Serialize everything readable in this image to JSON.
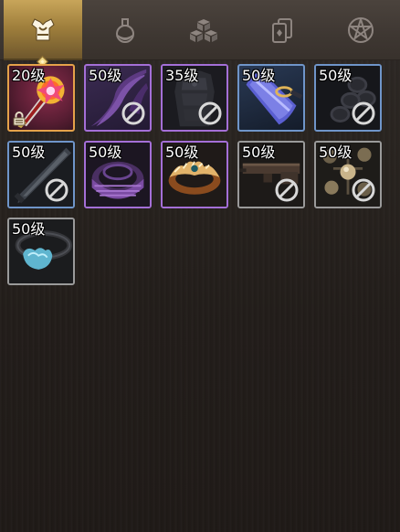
{
  "tabs": [
    {
      "id": "equipment",
      "icon": "armor-icon",
      "active": true
    },
    {
      "id": "potion",
      "icon": "potion-icon",
      "active": false
    },
    {
      "id": "materials",
      "icon": "cubes-icon",
      "active": false
    },
    {
      "id": "cards",
      "icon": "cards-icon",
      "active": false
    },
    {
      "id": "pentagram",
      "icon": "pentagram-icon",
      "active": false
    }
  ],
  "items": [
    {
      "level": "20级",
      "quality": "orange",
      "art": "fire-staff",
      "locked": true,
      "restricted": false
    },
    {
      "level": "50级",
      "quality": "purple",
      "art": "purple-cloak",
      "locked": false,
      "restricted": true
    },
    {
      "level": "35级",
      "quality": "purple",
      "art": "dark-armor",
      "locked": false,
      "restricted": true
    },
    {
      "level": "50级",
      "quality": "blue",
      "art": "blue-axe",
      "locked": false,
      "restricted": false
    },
    {
      "level": "50级",
      "quality": "blue",
      "art": "chain",
      "locked": false,
      "restricted": true
    },
    {
      "level": "50级",
      "quality": "blue",
      "art": "dark-blade",
      "locked": false,
      "restricted": true
    },
    {
      "level": "50级",
      "quality": "purple",
      "art": "purple-belt",
      "locked": false,
      "restricted": false
    },
    {
      "level": "50级",
      "quality": "purple",
      "art": "gold-ring",
      "locked": false,
      "restricted": false
    },
    {
      "level": "50级",
      "quality": "gray",
      "art": "gun",
      "locked": false,
      "restricted": true
    },
    {
      "level": "50级",
      "quality": "gray",
      "art": "orbs",
      "locked": false,
      "restricted": true
    },
    {
      "level": "50级",
      "quality": "gray",
      "art": "ice-collar",
      "locked": false,
      "restricted": false
    }
  ],
  "colors": {
    "tab_active": "#c8a55a",
    "quality_orange": "#e5a24a",
    "quality_purple": "#a46fd7",
    "quality_blue": "#6f95c9",
    "quality_gray": "#9a9a9a"
  }
}
